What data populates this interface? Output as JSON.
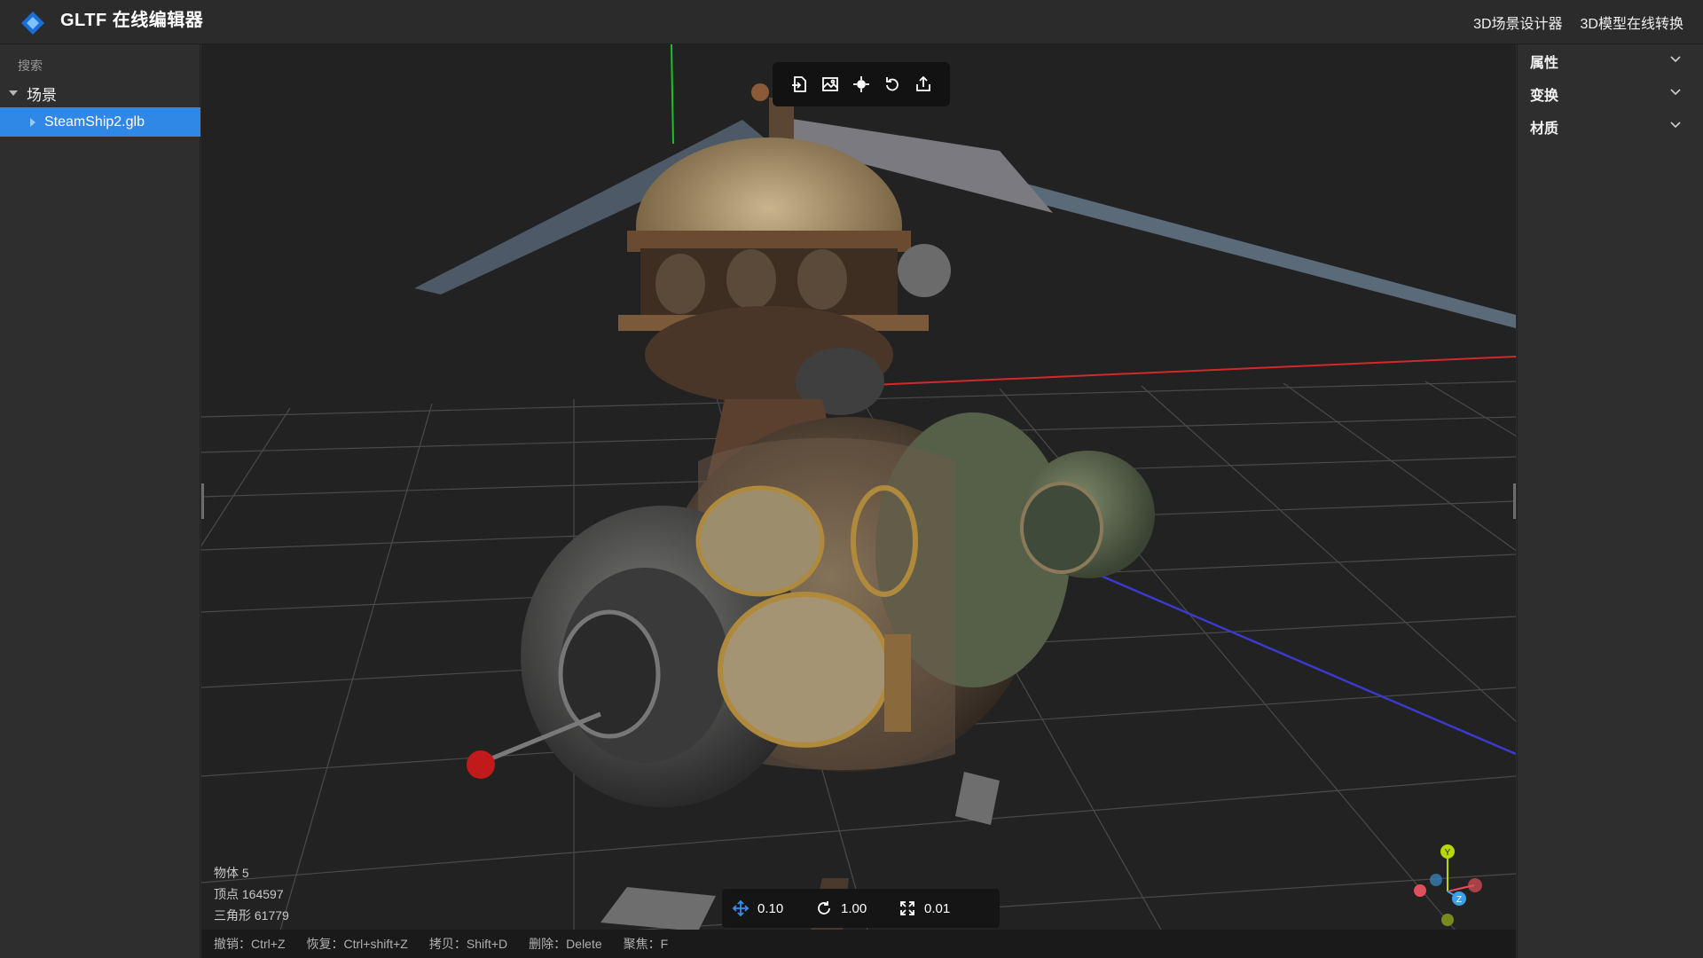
{
  "app": {
    "title": "GLTF 在线编辑器"
  },
  "header": {
    "links": [
      "3D场景设计器",
      "3D模型在线转换"
    ]
  },
  "sidebar": {
    "search_label": "搜索",
    "scene_label": "场景",
    "items": [
      {
        "label": "SteamShip2.glb",
        "selected": true
      }
    ]
  },
  "toolbar": {
    "buttons": [
      {
        "icon": "import-icon"
      },
      {
        "icon": "image-icon"
      },
      {
        "icon": "focus-icon"
      },
      {
        "icon": "reset-rotate-icon"
      },
      {
        "icon": "export-icon"
      }
    ]
  },
  "stats": {
    "objects": "物体 5",
    "vertices": "顶点 164597",
    "triangles": "三角形 61779"
  },
  "controls": {
    "translate": "0.10",
    "rotate": "1.00",
    "scale": "0.01"
  },
  "shortcuts": [
    "撤销：Ctrl+Z",
    "恢复：Ctrl+shift+Z",
    "拷贝：Shift+D",
    "删除：Delete",
    "聚焦：F"
  ],
  "gizmo": {
    "labels": {
      "y": "Y",
      "z": "Z"
    },
    "colors": {
      "x": "#e0505a",
      "y": "#b8d800",
      "z": "#3aa0e8"
    }
  },
  "rightpanel": {
    "sections": [
      "属性",
      "变换",
      "材质"
    ]
  },
  "colors": {
    "accent": "#2f88e6",
    "background": "#2b2b2b",
    "viewport": "#222222"
  }
}
